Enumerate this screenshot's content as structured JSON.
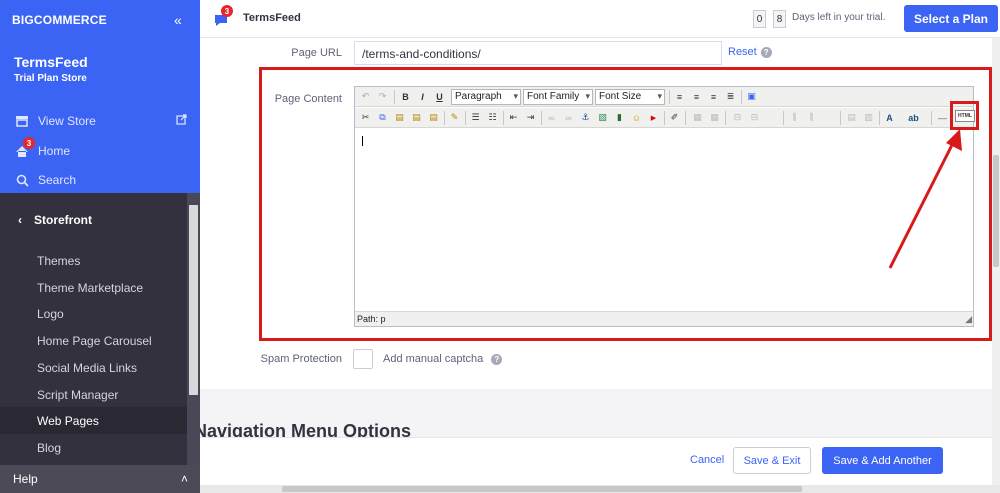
{
  "sidebar": {
    "brand": "BIGCOMMERCE",
    "store_name": "TermsFeed",
    "store_plan": "Trial Plan Store",
    "view_store": "View Store",
    "home": "Home",
    "home_badge": "3",
    "search": "Search",
    "section": "Storefront",
    "items": [
      "Themes",
      "Theme Marketplace",
      "Logo",
      "Home Page Carousel",
      "Social Media Links",
      "Script Manager",
      "Web Pages",
      "Blog"
    ],
    "active_item": "Web Pages",
    "help": "Help"
  },
  "topbar": {
    "title": "TermsFeed",
    "notification_badge": "3",
    "trial_days_1": "0",
    "trial_days_2": "8",
    "trial_text": "Days left in your trial.",
    "plan_button": "Select a Plan"
  },
  "form": {
    "page_url_label": "Page URL",
    "page_url_value": "/terms-and-conditions/",
    "reset": "Reset",
    "page_content_label": "Page Content",
    "editor": {
      "format_select": "Paragraph",
      "font_family_select": "Font Family",
      "font_size_select": "Font Size",
      "html_button": "HTML",
      "path": "Path: p"
    },
    "spam_label": "Spam Protection",
    "captcha_label": "Add manual captcha",
    "nav_menu_section": "Navigation Menu Options"
  },
  "footer": {
    "cancel": "Cancel",
    "save_exit": "Save & Exit",
    "save_add": "Save & Add Another"
  },
  "colors": {
    "brand_blue": "#3c64f4",
    "sidebar_dark": "#34313f",
    "highlight_red": "#d71a1a"
  }
}
